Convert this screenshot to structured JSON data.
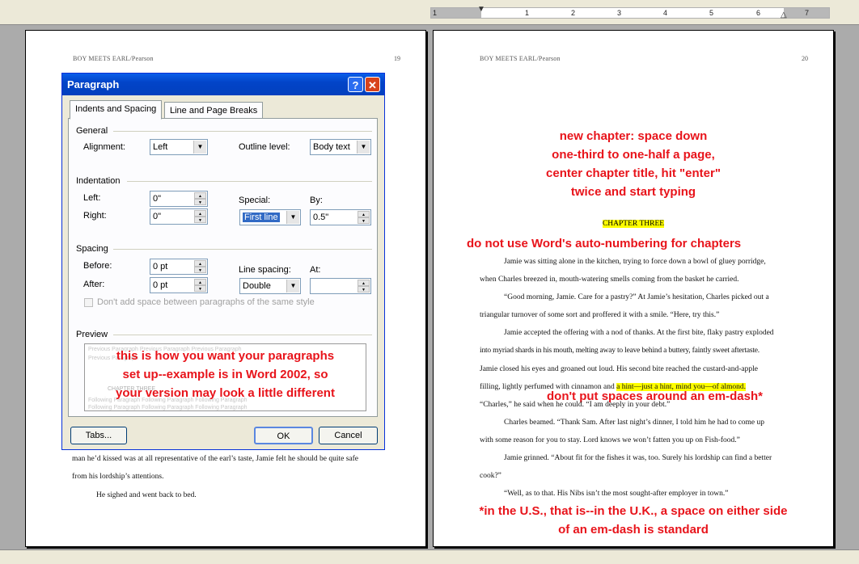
{
  "ruler": {
    "numbers": [
      "1",
      "1",
      "2",
      "3",
      "4",
      "5",
      "6",
      "7"
    ]
  },
  "pages": {
    "left": {
      "header": "BOY MEETS EARL/Pearson",
      "page_number": "19",
      "body_lines": [
        "man he’d kissed was at all representative of the earl’s taste, Jamie felt he should be quite safe",
        "from his lordship’s attentions.",
        "He sighed and went back to bed."
      ]
    },
    "right": {
      "header": "BOY MEETS EARL/Pearson",
      "page_number": "20",
      "chapter_title": "CHAPTER THREE",
      "body_lines": [
        "Jamie was sitting alone in the kitchen, trying to force down a bowl of gluey porridge,",
        "when Charles breezed in, mouth-watering smells coming from the basket he carried.",
        "“Good morning, Jamie. Care for a pastry?” At Jamie’s hesitation, Charles picked out a",
        "triangular turnover of some sort and proffered it with a smile. “Here, try this.”",
        "Jamie accepted the offering with a nod of thanks. At the first bite, flaky pastry exploded",
        "into myriad shards in his mouth, melting away to leave behind a buttery, faintly sweet aftertaste.",
        "Jamie closed his eyes and groaned out loud. His second bite reached the custard-and-apple",
        "filling, lightly perfumed with cinnamon and",
        "“Charles,” he said when he could. “I am deeply in your debt.”",
        "Charles beamed. “Thank Sam. After last night’s dinner, I told him he had to come up",
        "with some reason for you to stay. Lord knows we won’t fatten you up on Fish-food.”",
        "Jamie grinned. “About fit for the fishes it was, too. Surely his lordship can find a better",
        "cook?”",
        "“Well, as to that. His Nibs isn’t the most sought-after employer in town.”"
      ],
      "highlight_text": "a hint—just a hint, mind you—of almond."
    }
  },
  "annotations": {
    "new_chapter": [
      "new chapter:  space down",
      "one-third to one-half a page,",
      "center chapter title, hit \"enter\"",
      "twice and start typing"
    ],
    "no_auto_numbering": "do not use Word's auto-numbering for chapters",
    "em_dash": "don't put spaces around an em-dash*",
    "footnote": [
      "*in the U.S., that is--in the U.K., a space on either side",
      "of an em-dash is standard"
    ],
    "preview_note": [
      "this is how you want your paragraphs",
      "set up--example is in Word 2002, so",
      "your version may look a little different"
    ]
  },
  "dialog": {
    "title": "Paragraph",
    "help_glyph": "?",
    "close_glyph": "✕",
    "tabs": [
      "Indents and Spacing",
      "Line and Page Breaks"
    ],
    "general": {
      "label": "General",
      "alignment_label": "Alignment:",
      "alignment_value": "Left",
      "outline_label": "Outline level:",
      "outline_value": "Body text"
    },
    "indentation": {
      "label": "Indentation",
      "left_label": "Left:",
      "left_value": "0\"",
      "right_label": "Right:",
      "right_value": "0\"",
      "special_label": "Special:",
      "special_value": "First line",
      "by_label": "By:",
      "by_value": "0.5\""
    },
    "spacing": {
      "label": "Spacing",
      "before_label": "Before:",
      "before_value": "0 pt",
      "after_label": "After:",
      "after_value": "0 pt",
      "line_spacing_label": "Line spacing:",
      "line_spacing_value": "Double",
      "at_label": "At:",
      "at_value": ""
    },
    "checkbox_label": "Don't add space between paragraphs of the same style",
    "preview_label": "Preview",
    "preview_ghost": [
      "Previous Paragraph Previous Paragraph Previous Paragraph",
      "Previous Paragraph",
      "CHAPTER THREE",
      "Following Paragraph Following Paragraph Following Paragraph",
      "Following Paragraph Following Paragraph Following Paragraph"
    ],
    "buttons": {
      "tabs": "Tabs...",
      "ok": "OK",
      "cancel": "Cancel"
    }
  }
}
